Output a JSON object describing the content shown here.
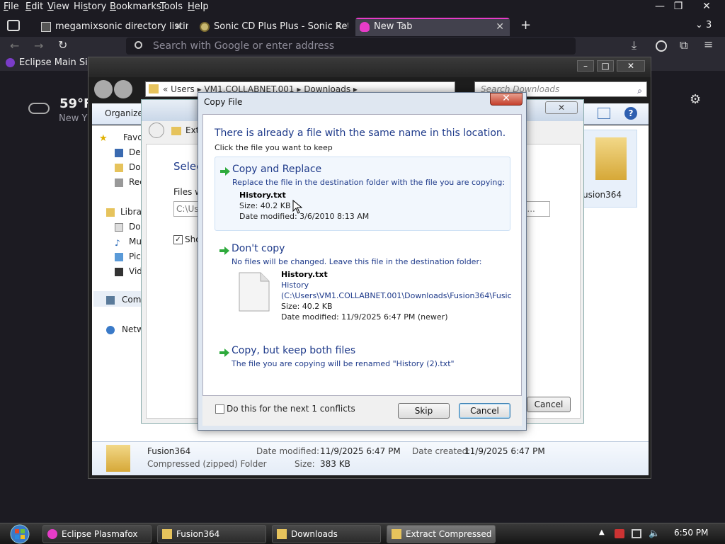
{
  "menubar": {
    "items": [
      {
        "pre": "",
        "u": "F",
        "post": "ile"
      },
      {
        "pre": "",
        "u": "E",
        "post": "dit"
      },
      {
        "pre": "",
        "u": "V",
        "post": "iew"
      },
      {
        "pre": "Hi",
        "u": "s",
        "post": "tory"
      },
      {
        "pre": "",
        "u": "B",
        "post": "ookmarks"
      },
      {
        "pre": "",
        "u": "T",
        "post": "ools"
      },
      {
        "pre": "",
        "u": "H",
        "post": "elp"
      }
    ]
  },
  "tabs": {
    "count": "3",
    "items": [
      {
        "label": "megamixsonic directory listing"
      },
      {
        "label": "Sonic CD Plus Plus - Sonic Retro"
      },
      {
        "label": "New Tab"
      }
    ]
  },
  "urlbar": {
    "placeholder": "Search with Google or enter address"
  },
  "bookmarks": {
    "item": "Eclipse Main Site"
  },
  "weather": {
    "temp": "59°F",
    "location": "New Y"
  },
  "explorer": {
    "address": [
      "Users",
      "VM1.COLLABNET.001",
      "Downloads"
    ],
    "search_placeholder": "Search Downloads",
    "organize": "Organize",
    "nav": {
      "favorites": "Favo",
      "desktop": "Des",
      "downloads": "Dow",
      "recent": "Rec",
      "libraries": "Libra",
      "documents": "Doc",
      "music": "Mu",
      "pictures": "Pic",
      "videos": "Vid",
      "computer": "Com",
      "network": "Netw"
    },
    "file_icon_label": "usion364",
    "details": {
      "name": "Fusion364",
      "type": "Compressed (zipped) Folder",
      "modified_label": "Date modified:",
      "modified": "11/9/2025 6:47 PM",
      "size_label": "Size:",
      "size": "383 KB",
      "created_label": "Date created:",
      "created": "11/9/2025 6:47 PM"
    }
  },
  "extract": {
    "title": "Extr",
    "heading": "Selec",
    "files_label": "Files w",
    "path": "C:\\Us",
    "show": "Sho",
    "browse": "e...",
    "cancel": "Cancel"
  },
  "copy_dialog": {
    "title": "Copy File",
    "heading": "There is already a file with the same name in this location.",
    "subheading": "Click the file you want to keep",
    "replace": {
      "title": "Copy and Replace",
      "desc": "Replace the file in the destination folder with the file you are copying:",
      "file": "History.txt",
      "size": "Size: 40.2 KB",
      "modified": "Date modified: 3/6/2010 8:13 AM"
    },
    "dont_copy": {
      "title": "Don't copy",
      "desc": "No files will be changed. Leave this file in the destination folder:",
      "file": "History.txt",
      "name": "History",
      "path": "(C:\\Users\\VM1.COLLABNET.001\\Downloads\\Fusion364\\Fusic",
      "size": "Size: 40.2 KB",
      "modified": "Date modified: 11/9/2025 6:47 PM (newer)"
    },
    "keep_both": {
      "title": "Copy, but keep both files",
      "desc": "The file you are copying will be renamed \"History (2).txt\""
    },
    "checkbox": "Do this for the next 1 conflicts",
    "skip": "Skip",
    "cancel": "Cancel",
    "close": "✕"
  },
  "taskbar": {
    "items": [
      {
        "label": "Eclipse Plasmafox"
      },
      {
        "label": "Fusion364"
      },
      {
        "label": "Downloads"
      },
      {
        "label": "Extract Compressed (..."
      }
    ],
    "clock": "6:50 PM"
  }
}
